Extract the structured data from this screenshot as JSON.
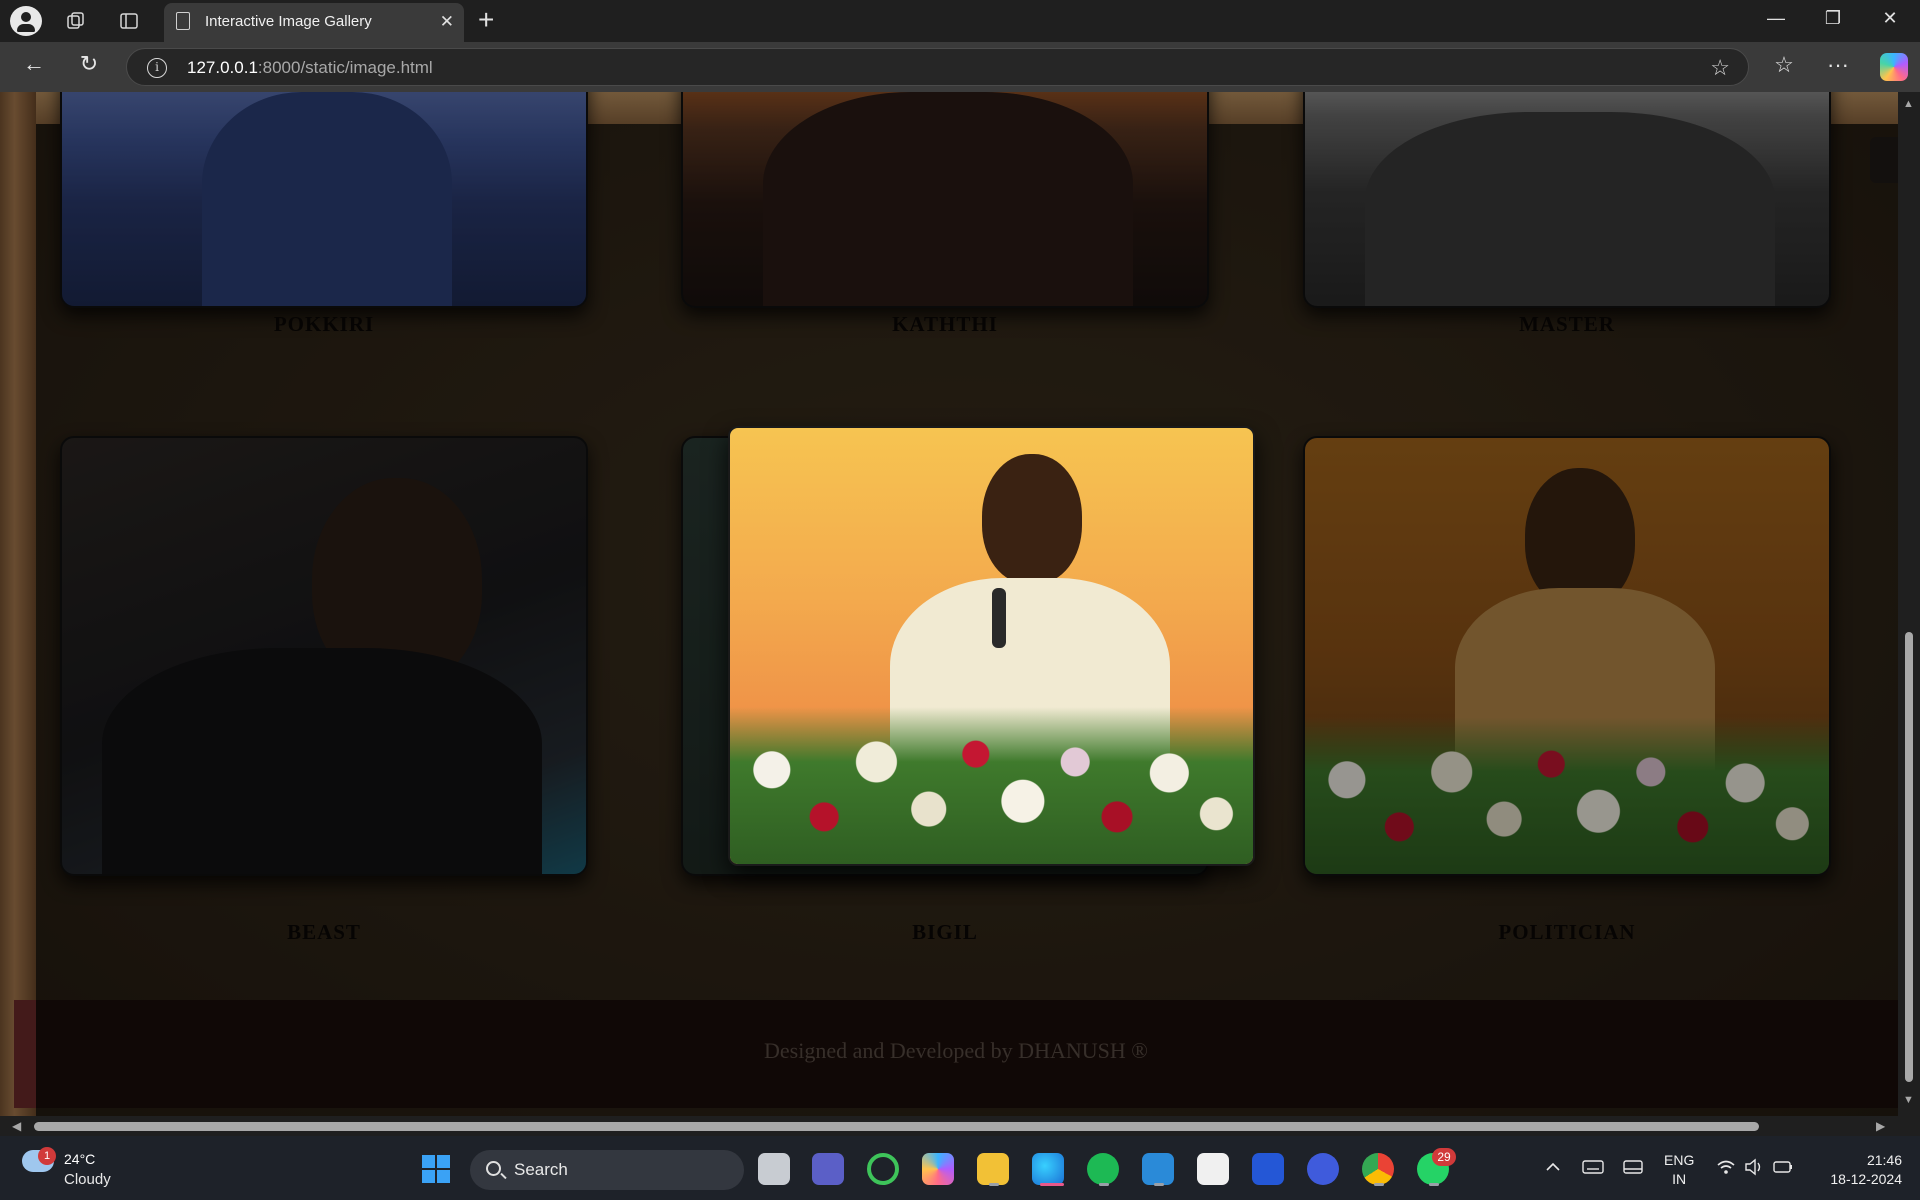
{
  "browser": {
    "tab_title": "Interactive Image Gallery",
    "tab_close": "✕",
    "new_tab": "+",
    "url_host": "127.0.0.1",
    "url_rest": ":8000/static/image.html",
    "info_glyph": "i",
    "back": "←",
    "refresh": "↻",
    "star": "☆",
    "favorites": "☆",
    "more": "···",
    "minimize": "—",
    "restore": "❐",
    "close": "✕"
  },
  "gallery": {
    "cards": [
      {
        "caption": "POKKIRI"
      },
      {
        "caption": "KATHTHI"
      },
      {
        "caption": "MASTER"
      },
      {
        "caption": "BEAST"
      },
      {
        "caption": "BIGIL"
      },
      {
        "caption": "POLITICIAN"
      }
    ]
  },
  "footer": {
    "text": "Designed and Developed by DHANUSH ®"
  },
  "taskbar": {
    "weather_temp": "24°C",
    "weather_desc": "Cloudy",
    "weather_badge": "1",
    "search_label": "Search",
    "whatsapp_badge": "29",
    "lang_line1": "ENG",
    "lang_line2": "IN",
    "time": "21:46",
    "date": "18-12-2024"
  },
  "icons": [
    "profile-icon",
    "workspaces-icon",
    "tab-actions-icon",
    "page-icon",
    "info-icon",
    "star-icon",
    "favorites-icon",
    "more-icon",
    "copilot-icon",
    "windows-logo-icon",
    "search-icon",
    "wifi-icon",
    "volume-icon",
    "battery-icon"
  ]
}
